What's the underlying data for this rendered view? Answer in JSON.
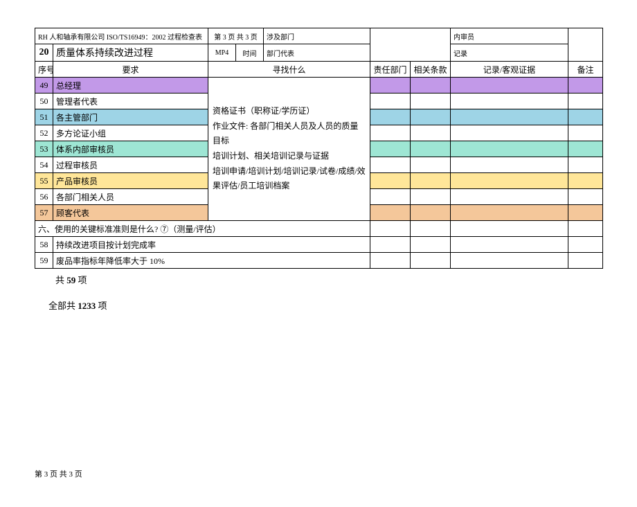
{
  "header": {
    "company": "RH 人和轴承有限公司 ISO/TS16949：2002 过程检查表",
    "page_top": "第 3 页 共 3 页",
    "sec_no": "20",
    "sec_title": "质量体系持续改进过程",
    "code": "MP4",
    "time_label": "时间",
    "dept_label": "涉及部门",
    "rep_label": "部门代表",
    "auditor_label": "内审员",
    "record_label": "记录"
  },
  "cols": {
    "seq": "序号",
    "req": "要求",
    "look": "寻找什么",
    "dept": "责任部门",
    "clause": "相关条款",
    "evidence": "记录/客观证据",
    "remark": "备注"
  },
  "rows": [
    {
      "n": "49",
      "req": "总经理",
      "cls": "color-purple"
    },
    {
      "n": "50",
      "req": "管理者代表",
      "cls": ""
    },
    {
      "n": "51",
      "req": "各主管部门",
      "cls": "color-blue"
    },
    {
      "n": "52",
      "req": "多方论证小组",
      "cls": ""
    },
    {
      "n": "53",
      "req": "体系内部审核员",
      "cls": "color-teal"
    },
    {
      "n": "54",
      "req": "过程审核员",
      "cls": ""
    },
    {
      "n": "55",
      "req": "产品审核员",
      "cls": "color-yellow"
    },
    {
      "n": "56",
      "req": "各部门相关人员",
      "cls": ""
    },
    {
      "n": "57",
      "req": "顾客代表",
      "cls": "color-orange"
    }
  ],
  "look_block": "资格证书（职称证/学历证）\n作业文件: 各部门相关人员及人员的质量目标\n培训计划、相关培训记录与证据\n培训申请/培训计划/培训记录/试卷/成绩/效果评估/员工培训档案",
  "section6": "六、使用的关键标准准则是什么?  ⑦（测量/评估）",
  "r58": {
    "n": "58",
    "req": "持续改进项目按计划完成率"
  },
  "r59": {
    "n": "59",
    "req": "废品率指标年降低率大于 10%"
  },
  "sum1_a": "共  ",
  "sum1_b": "59",
  "sum1_c": "   项",
  "sum2_a": "全部共 ",
  "sum2_b": "1233",
  "sum2_c": " 项",
  "footer": "第 3 页 共 3 页"
}
